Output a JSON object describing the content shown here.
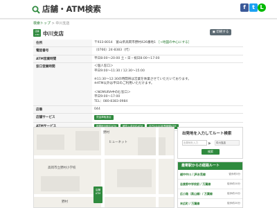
{
  "header": {
    "title": "店舗・ATM検索",
    "social": {
      "facebook": "f",
      "twitter": "t",
      "line": "L"
    }
  },
  "breadcrumb": {
    "home": "検索トップ",
    "sep": " > ",
    "current": "中川支店"
  },
  "branch": {
    "badge": "店舗 ATM",
    "name": "中川支店",
    "print_label": "印刷する"
  },
  "info": {
    "rows": [
      {
        "label": "住所",
        "value": "〒933-8014　富山県高岡市野村426番地1",
        "link": "［→地図の中心にする］"
      },
      {
        "label": "電話番号",
        "value": "（0766）24-8383（代）"
      },
      {
        "label": "ATM営業時間",
        "value": "平日8:00～20:00 土・日・祝日8:00～17:00"
      },
      {
        "label": "窓口営業時間",
        "lines": [
          "＜個人窓口＞",
          "平日9:00～11:30 / 12:30～15:00",
          "",
          "※11:30～12:30の時間帯は営業を休業させていただいております。",
          "※ATM以外は平日のご利用いただけます。",
          "",
          "＜NOMURA中のむ窓口＞",
          "平日9:00～17:00",
          "TEL：080-8383-0984"
        ]
      },
      {
        "label": "店番",
        "value": "044"
      },
      {
        "label": "店舗サービス",
        "tags": [
          "貸金庫取扱店"
        ]
      },
      {
        "label": "ATMサービス",
        "tags": [
          "振替総合取引ATM",
          "硬貨入金対応ATM",
          "平日20:00延長稼働ATM"
        ]
      }
    ]
  },
  "map": {
    "labels": [
      "野村",
      "高岡市立野村小学校",
      "野村",
      "ヒューネット"
    ],
    "pin": "店舗 ATM"
  },
  "route": {
    "title": "出発地を入力してルート検索",
    "from_placeholder": "出発地を入力",
    "arrow": "▶",
    "to": "中川支店",
    "button": "検索"
  },
  "access": {
    "title": "最寄駅からの経路ルート",
    "items": [
      {
        "name": "越中中川 / JR氷見線",
        "time": "徒歩約5分"
      },
      {
        "name": "志貴野中学校前 / 万葉線",
        "time": "徒歩約10分"
      },
      {
        "name": "広小路（高山線）/ 万葉線",
        "time": "徒歩約15分"
      },
      {
        "name": "末広町 / 万葉線",
        "time": "徒歩約20分"
      }
    ]
  }
}
